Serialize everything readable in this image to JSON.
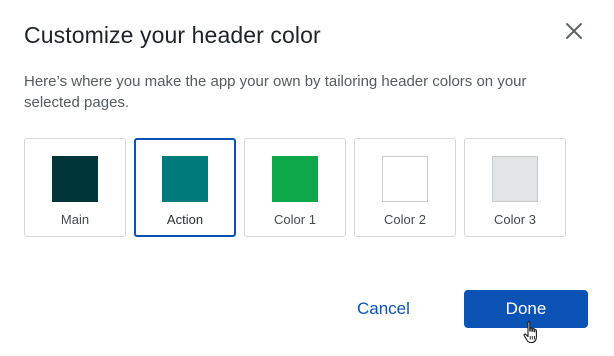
{
  "dialog": {
    "title": "Customize your header color",
    "close_icon": "close-icon",
    "description": "Here’s where you make the app your own by tailoring header colors on your selected pages."
  },
  "swatches": [
    {
      "label": "Main",
      "color": "#00363a",
      "selected": false
    },
    {
      "label": "Action",
      "color": "#007a7a",
      "selected": true
    },
    {
      "label": "Color 1",
      "color": "#0ea84b",
      "selected": false
    },
    {
      "label": "Color 2",
      "color": "#ffffff",
      "selected": false
    },
    {
      "label": "Color 3",
      "color": "#e3e4e5",
      "selected": false
    }
  ],
  "footer": {
    "cancel_label": "Cancel",
    "done_label": "Done"
  },
  "colors": {
    "accent": "#0b52b5"
  },
  "cursor_icon": "hand-pointer-icon"
}
